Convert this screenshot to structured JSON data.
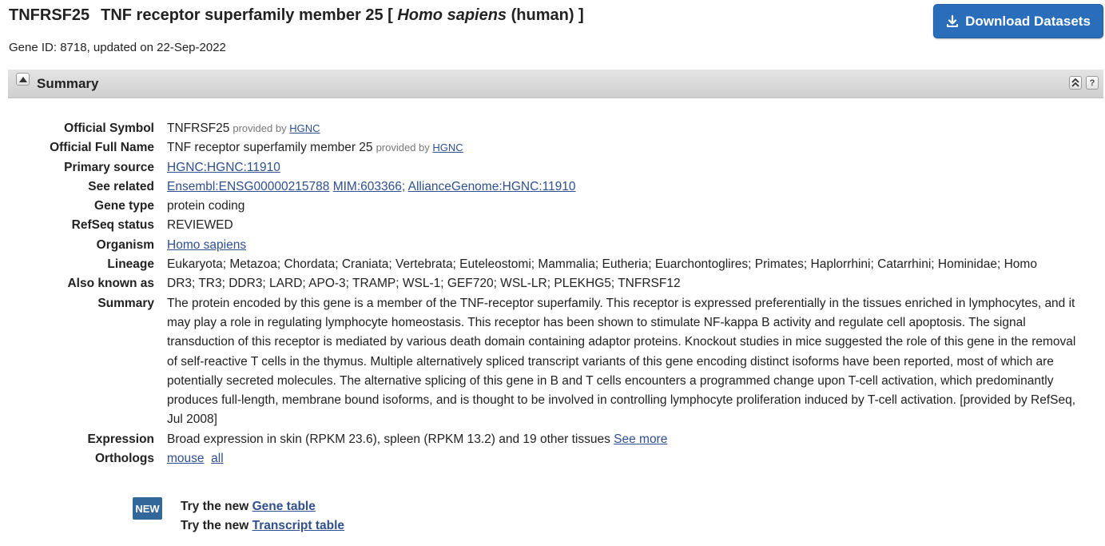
{
  "header": {
    "symbol": "TNFRSF25",
    "name_prefix": "TNF receptor superfamily member 25 [ ",
    "species": "Homo sapiens",
    "name_suffix": " (human) ]",
    "gene_id_line": "Gene ID: 8718, updated on 22-Sep-2022",
    "download_label": "Download Datasets"
  },
  "summary_section": {
    "title": "Summary",
    "collapse_all_icon": "double-up-arrow-icon",
    "help_icon": "question-mark-icon"
  },
  "rows": {
    "official_symbol": {
      "label": "Official Symbol",
      "value": "TNFRSF25",
      "provided_by": "provided by",
      "source": "HGNC"
    },
    "official_full_name": {
      "label": "Official Full Name",
      "value": "TNF receptor superfamily member 25",
      "provided_by": "provided by",
      "source": "HGNC"
    },
    "primary_source": {
      "label": "Primary source",
      "link": "HGNC:HGNC:11910"
    },
    "see_related": {
      "label": "See related",
      "links": [
        "Ensembl:ENSG00000215788",
        "MIM:603366;",
        "AllianceGenome:HGNC:11910"
      ]
    },
    "gene_type": {
      "label": "Gene type",
      "value": "protein coding"
    },
    "refseq_status": {
      "label": "RefSeq status",
      "value": "REVIEWED"
    },
    "organism": {
      "label": "Organism",
      "link": "Homo sapiens"
    },
    "lineage": {
      "label": "Lineage",
      "value": "Eukaryota; Metazoa; Chordata; Craniata; Vertebrata; Euteleostomi; Mammalia; Eutheria; Euarchontoglires; Primates; Haplorrhini; Catarrhini; Hominidae; Homo"
    },
    "also_known_as": {
      "label": "Also known as",
      "value": "DR3; TR3; DDR3; LARD; APO-3; TRAMP; WSL-1; GEF720; WSL-LR; PLEKHG5; TNFRSF12"
    },
    "summary": {
      "label": "Summary",
      "value": "The protein encoded by this gene is a member of the TNF-receptor superfamily. This receptor is expressed preferentially in the tissues enriched in lymphocytes, and it may play a role in regulating lymphocyte homeostasis. This receptor has been shown to stimulate NF-kappa B activity and regulate cell apoptosis. The signal transduction of this receptor is mediated by various death domain containing adaptor proteins. Knockout studies in mice suggested the role of this gene in the removal of self-reactive T cells in the thymus. Multiple alternatively spliced transcript variants of this gene encoding distinct isoforms have been reported, most of which are potentially secreted molecules. The alternative splicing of this gene in B and T cells encounters a programmed change upon T-cell activation, which predominantly produces full-length, membrane bound isoforms, and is thought to be involved in controlling lymphocyte proliferation induced by T-cell activation. [provided by RefSeq, Jul 2008]"
    },
    "expression": {
      "label": "Expression",
      "value": "Broad expression in skin (RPKM 23.6), spleen (RPKM 13.2) and 19 other tissues",
      "link": "See more"
    },
    "orthologs": {
      "label": "Orthologs",
      "links": [
        "mouse",
        "all"
      ]
    }
  },
  "new_promo": {
    "badge": "NEW",
    "try_prefix": "Try the new",
    "gene_table": "Gene table",
    "transcript_table": "Transcript table"
  },
  "colors": {
    "accent_button": "#2a6ebb",
    "link": "#2f4f8f",
    "badge": "#336699"
  }
}
